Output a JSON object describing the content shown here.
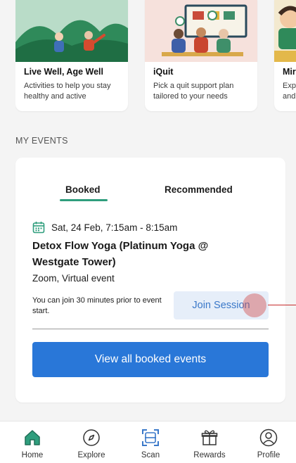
{
  "programs": [
    {
      "title": "Live Well, Age Well",
      "description": "Activities to help you stay healthy and active"
    },
    {
      "title": "iQuit",
      "description": "Pick a quit support plan tailored to your needs"
    },
    {
      "title": "Mir",
      "description": "Exp and"
    }
  ],
  "section": {
    "title": "MY EVENTS"
  },
  "tabs": {
    "booked": "Booked",
    "recommended": "Recommended"
  },
  "event": {
    "datetime": "Sat, 24 Feb, 7:15am - 8:15am",
    "title": "Detox Flow Yoga (Platinum Yoga @ Westgate Tower)",
    "location": "Zoom, Virtual event",
    "note": "You can join 30 minutes prior to event start.",
    "join_label": "Join Session"
  },
  "view_all_label": "View all booked events",
  "nav": [
    {
      "label": "Home",
      "icon": "home-icon",
      "active": true
    },
    {
      "label": "Explore",
      "icon": "compass-icon"
    },
    {
      "label": "Scan",
      "icon": "scan-icon"
    },
    {
      "label": "Rewards",
      "icon": "gift-icon"
    },
    {
      "label": "Profile",
      "icon": "profile-icon"
    }
  ],
  "colors": {
    "accent": "#2977d8",
    "tab_underline": "#2f9e7d",
    "home_active": "#2f9e7d",
    "scan": "#3a78c9"
  }
}
